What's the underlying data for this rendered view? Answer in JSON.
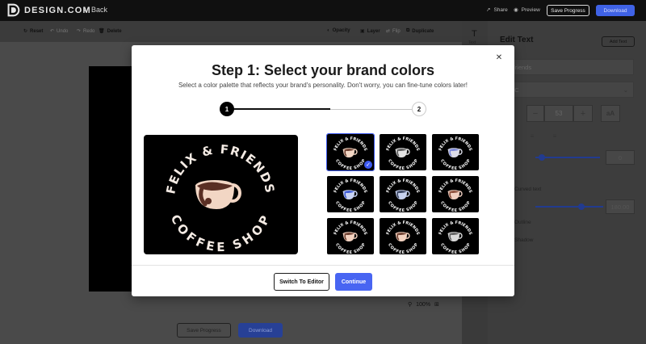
{
  "app": {
    "logo_text": "DESIGN.COM",
    "back_label": "Back"
  },
  "topbar": {
    "share_label": "Share",
    "preview_label": "Preview",
    "save_label": "Save Progress",
    "download_label": "Download"
  },
  "toolbar": {
    "reset_label": "Reset",
    "undo_label": "Undo",
    "redo_label": "Redo",
    "delete_label": "Delete",
    "opacity_label": "Opacity",
    "layer_label": "Layer",
    "flip_label": "Flip",
    "duplicate_label": "Duplicate"
  },
  "rail": {
    "text_label": "Text"
  },
  "panel": {
    "title": "Edit Text",
    "add_text_label": "Add Text",
    "text_value": "& Friends",
    "font_value": "o BC",
    "size_minus": "−",
    "size_value": "53",
    "size_plus": "+",
    "case_label": "aA",
    "spacing_value": "0",
    "curved_label": "Curved text",
    "curve_value": "180.00",
    "outline_label": "Outline",
    "shadow_label": "Shadow",
    "letter_spacing_fraction": 0.1,
    "curve_fraction": 0.68
  },
  "canvas": {
    "zoom_value": "100%",
    "save_label": "Save Progress",
    "download_label": "Download"
  },
  "modal": {
    "title": "Step 1: Select your brand colors",
    "subtitle": "Select a color palette that reflects your brand's personality. Don't worry, you can fine-tune colors later!",
    "step1": "1",
    "step2": "2",
    "close_icon": "close-icon",
    "switch_label": "Switch To Editor",
    "continue_label": "Continue",
    "preview": {
      "line1": "FELIX & FRIENDS",
      "line2": "COFFEE SHOP"
    },
    "thumb_line1": "FELIX & FRIENDS",
    "thumb_line2": "COFFEE SHOP",
    "palettes": [
      {
        "cup": "#f2d6c4",
        "coffee": "#6b3d2e",
        "text": "#ffffff",
        "selected": true
      },
      {
        "cup": "#e3e3e3",
        "coffee": "#5a5a5a",
        "text": "#ffffff",
        "selected": false
      },
      {
        "cup": "#dcdde8",
        "coffee": "#7a86d8",
        "text": "#ffffff",
        "selected": false
      },
      {
        "cup": "#c9d4f5",
        "coffee": "#3b58d6",
        "text": "#ffffff",
        "selected": false
      },
      {
        "cup": "#c7d2f0",
        "coffee": "#36415e",
        "text": "#ffffff",
        "selected": false
      },
      {
        "cup": "#f0cfc1",
        "coffee": "#8a4d3a",
        "text": "#ffffff",
        "selected": false
      },
      {
        "cup": "#f3d2c0",
        "coffee": "#6b3d2e",
        "text": "#ffffff",
        "selected": false
      },
      {
        "cup": "#f4d3c1",
        "coffee": "#6b3d2e",
        "text": "#ffffff",
        "selected": false
      },
      {
        "cup": "#d9d9d9",
        "coffee": "#5f5f5f",
        "text": "#ffffff",
        "selected": false
      }
    ]
  },
  "colors": {
    "accent": "#4865f2",
    "modal_bg": "#ffffff",
    "page_overlay": "#4a4a4a",
    "brand_preview_cup": "#f2d6c4",
    "brand_preview_coffee": "#5a2f24",
    "brand_preview_text": "#f4ebe4"
  }
}
